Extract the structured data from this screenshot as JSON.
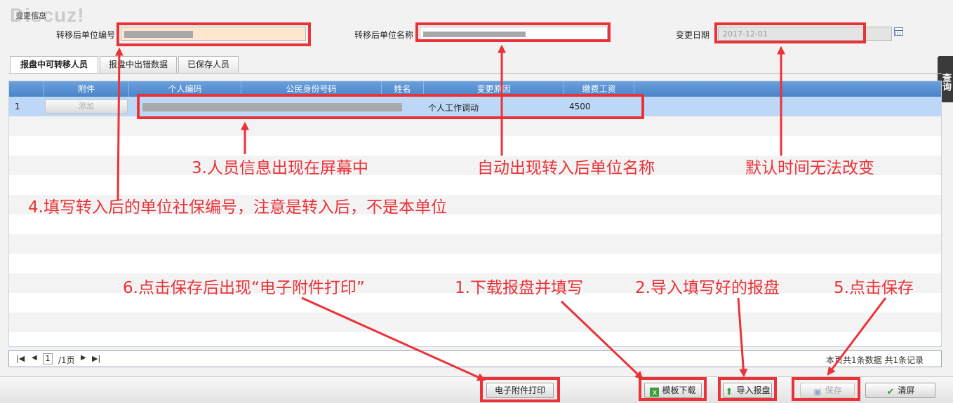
{
  "watermark": "Discuz!",
  "form": {
    "section_title": "变更信息",
    "unit_code_label": "转移后单位编号",
    "unit_name_label": "转移后单位名称",
    "change_date_label": "变更日期",
    "change_date_value": "2017-12-01"
  },
  "tabs": [
    {
      "label": "报盘中可转移人员",
      "active": true
    },
    {
      "label": "报盘中出错数据",
      "active": false
    },
    {
      "label": "已保存人员",
      "active": false
    }
  ],
  "side_tab": "查询",
  "grid": {
    "columns": [
      "附件",
      "个人编码",
      "公民身份号码",
      "姓名",
      "变更原因",
      "缴费工资"
    ],
    "rows": [
      {
        "index": "1",
        "attachment_button": "添加",
        "reason": "个人工作调动",
        "wage": "4500"
      }
    ]
  },
  "pager": {
    "current_page": "1",
    "total_pages": "/1页",
    "summary": "本页共1条数据 共1条记录"
  },
  "buttons": {
    "print_attachment": "电子附件打印",
    "template_download": "模板下载",
    "import_disk": "导入报盘",
    "save": "保存",
    "clear": "清屏"
  },
  "annotations": {
    "step1": "1.下载报盘并填写",
    "step2": "2.导入填写好的报盘",
    "step3": "3.人员信息出现在屏幕中",
    "step4": "4.填写转入后的单位社保编号，注意是转入后，不是本单位",
    "step5": "5.点击保存",
    "step6": "6.点击保存后出现“电子附件打印”",
    "auto_name": "自动出现转入后单位名称",
    "default_date": "默认时间无法改变"
  },
  "colors": {
    "annotation_red": "#e93339",
    "grid_header": "#4a84c8",
    "selected_row": "#bcd8f6",
    "highlight_field": "#ffe6cf"
  }
}
